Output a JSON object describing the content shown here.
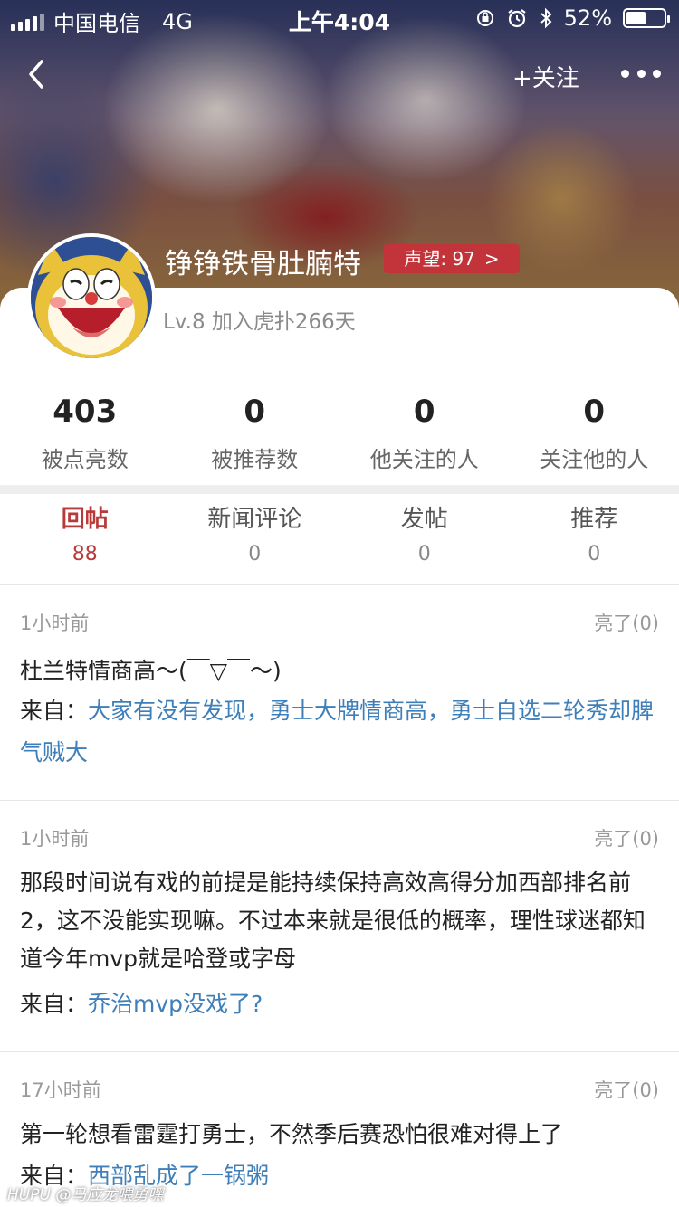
{
  "status_bar": {
    "carrier": "中国电信",
    "network": "4G",
    "time": "上午4:04",
    "battery": "52%",
    "battery_level": 0.52
  },
  "nav": {
    "follow_label": "+关注"
  },
  "profile": {
    "username": "铮铮铁骨肚腩特",
    "prestige_label": "声望: 97",
    "prestige_arrow": ">",
    "level": "Lv.8 加入虎扑266天"
  },
  "stats": [
    {
      "value": "403",
      "label": "被点亮数"
    },
    {
      "value": "0",
      "label": "被推荐数"
    },
    {
      "value": "0",
      "label": "他关注的人"
    },
    {
      "value": "0",
      "label": "关注他的人"
    }
  ],
  "tabs": [
    {
      "label": "回帖",
      "count": "88"
    },
    {
      "label": "新闻评论",
      "count": "0"
    },
    {
      "label": "发帖",
      "count": "0"
    },
    {
      "label": "推荐",
      "count": "0"
    }
  ],
  "posts": [
    {
      "time": "1小时前",
      "likes": "亮了(0)",
      "content": "杜兰特情商高～(￣▽￣～)",
      "from_prefix": "来自：",
      "from_link": "大家有没有发现，勇士大牌情商高，勇士自选二轮秀却脾气贼大"
    },
    {
      "time": "1小时前",
      "likes": "亮了(0)",
      "content": "那段时间说有戏的前提是能持续保持高效高得分加西部排名前2，这不没能实现嘛。不过本来就是很低的概率，理性球迷都知道今年mvp就是哈登或字母",
      "from_prefix": "来自：",
      "from_link": "乔治mvp没戏了?"
    },
    {
      "time": "17小时前",
      "likes": "亮了(0)",
      "content": "第一轮想看雷霆打勇士，不然季后赛恐怕很难对得上了",
      "from_prefix": "来自：",
      "from_link": "西部乱成了一锅粥"
    }
  ],
  "watermark": "HUPU @马应龙喂勇嘿"
}
